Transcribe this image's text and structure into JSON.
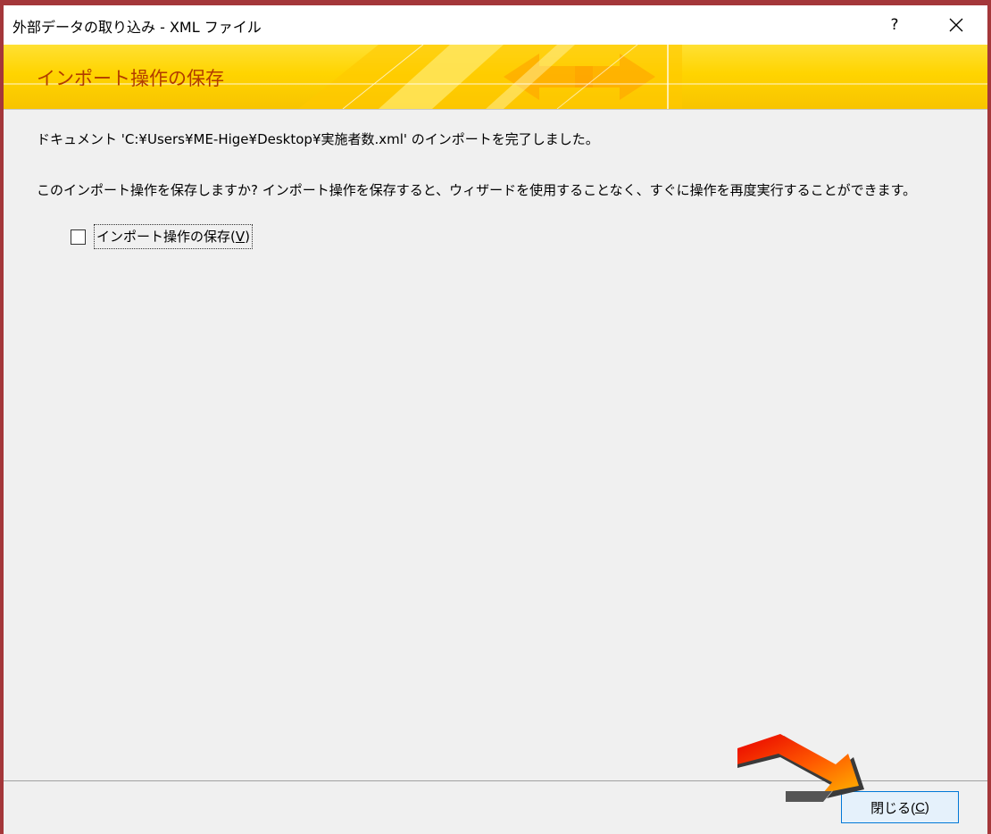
{
  "window": {
    "title": "外部データの取り込み - XML ファイル",
    "help_label": "?",
    "accent_color": "#a4373a"
  },
  "banner": {
    "title": "インポート操作の保存",
    "title_color": "#b23c00",
    "background_color": "#ffd400"
  },
  "content": {
    "completion_message": "ドキュメント 'C:¥Users¥ME-Hige¥Desktop¥実施者数.xml' のインポートを完了しました。",
    "save_prompt": "このインポート操作を保存しますか? インポート操作を保存すると、ウィザードを使用することなく、すぐに操作を再度実行することができます。",
    "save_checkbox": {
      "label_prefix": "インポート操作の保存(",
      "label_accel": "V",
      "label_suffix": ")",
      "checked": false
    }
  },
  "footer": {
    "close_button": {
      "label_prefix": "閉じる(",
      "label_accel": "C",
      "label_suffix": ")"
    }
  },
  "icons": {
    "close": "close-icon",
    "pointer_arrow": "arrow-pointer-icon"
  }
}
